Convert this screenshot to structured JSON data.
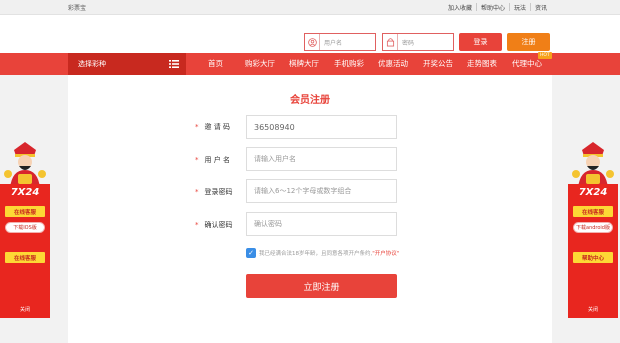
{
  "topbar": {
    "site_name": "彩票宝",
    "links": [
      "加入收藏",
      "帮助中心",
      "玩法",
      "资讯"
    ]
  },
  "header": {
    "username_placeholder": "用户名",
    "password_placeholder": "密码",
    "login_label": "登录",
    "register_label": "注册"
  },
  "nav": {
    "lottery_select": "选择彩种",
    "items": [
      "首页",
      "购彩大厅",
      "棋牌大厅",
      "手机购彩",
      "优惠活动",
      "开奖公告",
      "走势图表",
      "代理中心"
    ],
    "hot_badge": "HOT"
  },
  "form": {
    "title": "会员注册",
    "fields": [
      {
        "label": "邀 请 码",
        "value": "36508940",
        "required": true
      },
      {
        "label": "用 户 名",
        "placeholder": "请输入用户名",
        "required": true
      },
      {
        "label": "登录密码",
        "placeholder": "请输入6～12个字母或数字组合",
        "required": true
      },
      {
        "label": "确认密码",
        "placeholder": "确认密码",
        "required": true
      }
    ],
    "agreement_text": "我已经满合法18岁年龄，且同意各项开户条约,",
    "agreement_link": "\"开户协议\"",
    "submit_label": "立即注册"
  },
  "side_left": {
    "brand": "7X24",
    "buttons": [
      "在线客服",
      "下载IOS版",
      "在线客服"
    ],
    "close": "关闭"
  },
  "side_right": {
    "brand": "7X24",
    "buttons": [
      "在线客服",
      "下载android版",
      "帮助中心"
    ],
    "close": "关闭"
  },
  "colors": {
    "brand_red": "#e8433a",
    "dark_red": "#c8291f",
    "orange": "#f07f17",
    "checkbox_blue": "#3a8ee6",
    "side_yellow": "#fdd835"
  }
}
